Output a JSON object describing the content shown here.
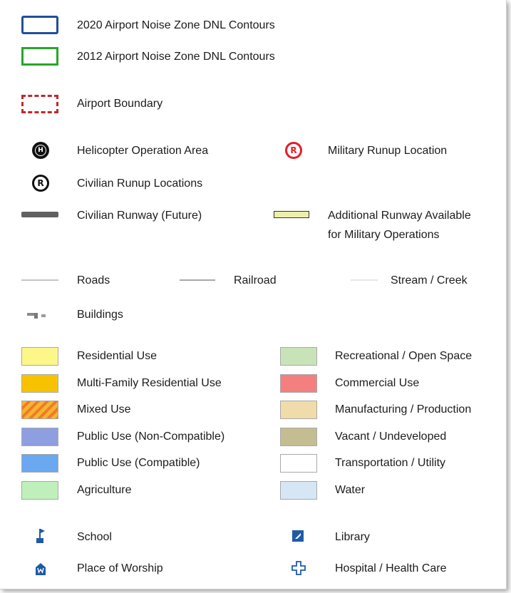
{
  "legend": {
    "contours": [
      {
        "label": "2020 Airport Noise Zone DNL Contours",
        "color": "#1f4f9c"
      },
      {
        "label": "2012 Airport Noise Zone DNL Contours",
        "color": "#2aa52a"
      },
      {
        "label": "Airport Boundary",
        "color": "#c0282f"
      }
    ],
    "points": {
      "helicopter": {
        "label": "Helicopter Operation Area",
        "glyph": "H"
      },
      "military_runup": {
        "label": "Military Runup Location",
        "glyph": "R",
        "color": "#e0202a"
      },
      "civilian_runup": {
        "label": "Civilian Runup Locations",
        "glyph": "R"
      }
    },
    "runways": {
      "civilian": {
        "label": "Civilian Runway (Future)",
        "color": "#606060"
      },
      "additional_line1": "Additional Runway Available",
      "additional_line2": "for Military Operations",
      "additional_color": "#eef0a8"
    },
    "lines": {
      "roads": "Roads",
      "railroad": "Railroad",
      "stream": "Stream / Creek",
      "buildings": "Buildings"
    },
    "land_use_left": [
      {
        "label": "Residential Use",
        "color": "#fdf78a"
      },
      {
        "label": "Multi-Family Residential Use",
        "color": "#f7c300"
      },
      {
        "label": "Mixed Use",
        "color": "#f5b530",
        "hatch": "#f07a2a"
      },
      {
        "label": "Public Use (Non-Compatible)",
        "color": "#8d9fe0"
      },
      {
        "label": "Public Use (Compatible)",
        "color": "#6aa8f0"
      },
      {
        "label": "Agriculture",
        "color": "#bff0bb"
      }
    ],
    "land_use_right": [
      {
        "label": "Recreational / Open Space",
        "color": "#c9e3b8"
      },
      {
        "label": "Commercial Use",
        "color": "#f47f7f"
      },
      {
        "label": "Manufacturing / Production",
        "color": "#efdcaa"
      },
      {
        "label": "Vacant / Undeveloped",
        "color": "#c5bd92"
      },
      {
        "label": "Transportation / Utility",
        "color": "#ffffff"
      },
      {
        "label": "Water",
        "color": "#d6e6f5"
      }
    ],
    "facilities": {
      "school": "School",
      "library": "Library",
      "worship": "Place of Worship",
      "hospital": "Hospital / Health Care",
      "icon_color": "#1f5aa8"
    }
  }
}
